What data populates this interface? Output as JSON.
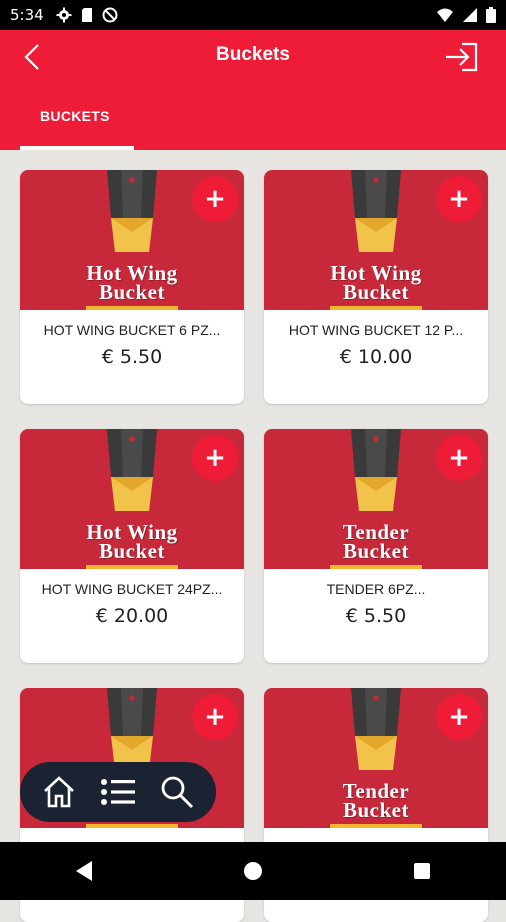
{
  "status_bar": {
    "time": "5:34",
    "icons_left": [
      "settings-gear-icon",
      "sd-card-icon",
      "do-not-disturb-icon"
    ],
    "icons_right": [
      "wifi-icon",
      "signal-icon",
      "battery-icon"
    ]
  },
  "app_bar": {
    "title": "Buckets",
    "back_icon": "back-arrow-icon",
    "logout_icon": "logout-icon",
    "background": "#ef1c38"
  },
  "tabs": [
    {
      "label": "BUCKETS",
      "active": true
    }
  ],
  "products": [
    {
      "brand_line1": "Hot Wing",
      "brand_line2": "Bucket",
      "name": "HOT WING BUCKET 6 PZ...",
      "price": "€ 5.50",
      "add_label": "+"
    },
    {
      "brand_line1": "Hot Wing",
      "brand_line2": "Bucket",
      "name": "HOT WING BUCKET 12 P...",
      "price": "€ 10.00",
      "add_label": "+"
    },
    {
      "brand_line1": "Hot Wing",
      "brand_line2": "Bucket",
      "name": "HOT WING BUCKET 24PZ...",
      "price": "€ 20.00",
      "add_label": "+"
    },
    {
      "brand_line1": "Tender",
      "brand_line2": "Bucket",
      "name": "TENDER 6PZ...",
      "price": "€ 5.50",
      "add_label": "+"
    },
    {
      "brand_line1": "",
      "brand_line2": "",
      "name": "",
      "price": "",
      "add_label": "+"
    },
    {
      "brand_line1": "Tender",
      "brand_line2": "Bucket",
      "name": "",
      "price": "",
      "add_label": "+"
    }
  ],
  "bottom_nav": {
    "items": [
      "home-icon",
      "list-icon",
      "search-icon"
    ],
    "background": "#1b2332"
  },
  "system_nav": [
    "back-triangle-icon",
    "home-circle-icon",
    "recents-square-icon"
  ],
  "colors": {
    "accent": "#ef1c38",
    "card_image_bg": "#c7283a",
    "page_bg": "#e6e5e1"
  }
}
